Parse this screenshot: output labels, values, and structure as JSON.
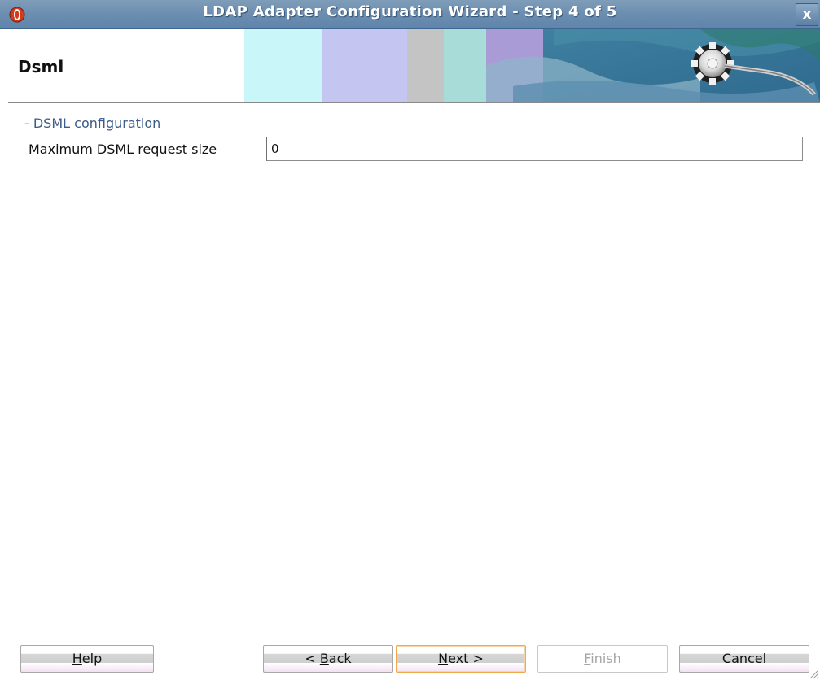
{
  "window": {
    "title": "LDAP Adapter Configuration Wizard - Step 4 of 5",
    "close_glyph": "x",
    "logo_icon": "oracle-logo-icon"
  },
  "header": {
    "page_heading": "Dsml",
    "banner_icon": "gear-plug-icon"
  },
  "group": {
    "title": "- DSML configuration",
    "field_label": "Maximum DSML request size",
    "field_value": "0"
  },
  "buttons": {
    "help": {
      "pre": "",
      "key": "H",
      "post": "elp"
    },
    "back": {
      "pre": "< ",
      "key": "B",
      "post": "ack"
    },
    "next": {
      "pre": "",
      "key": "N",
      "post": "ext >"
    },
    "finish": {
      "pre": "",
      "key": "F",
      "post": "inish"
    },
    "cancel": {
      "pre": "Cancel",
      "key": "",
      "post": ""
    }
  },
  "colors": {
    "titlebar": "#6b8db0",
    "group_title": "#3b5b8a",
    "focus_border": "#f0a94a"
  }
}
